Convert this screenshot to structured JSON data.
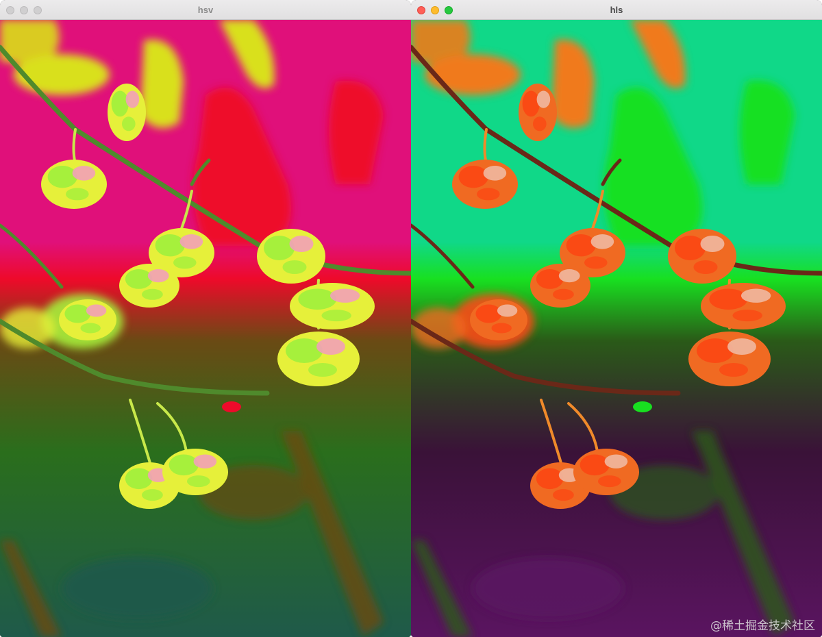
{
  "windows": [
    {
      "id": "hsv",
      "title": "hsv",
      "focused": false,
      "colors": {
        "sky": "#e0107a",
        "skyPatch": "#ee0a2a",
        "leaf": "#d9e01a",
        "midground": "#6a4a14",
        "ground": "#2a6e1c",
        "groundDeep": "#1f5a4a",
        "branch": "#4f8a2c",
        "berryA": "#e6f03a",
        "berryB": "#a6f03c",
        "berryC": "#f2a0b8",
        "stem": "#c8e84a"
      }
    },
    {
      "id": "hls",
      "title": "hls",
      "focused": true,
      "colors": {
        "sky": "#10d888",
        "skyPatch": "#18e020",
        "leaf": "#f07a1a",
        "midground": "#2a5a18",
        "ground": "#3a1238",
        "groundDeep": "#5a1460",
        "branch": "#6a2818",
        "berryA": "#f06a22",
        "berryB": "#fa4a14",
        "berryC": "#f0b8a0",
        "stem": "#f08a2a"
      }
    }
  ],
  "watermark": "@稀土掘金技术社区"
}
